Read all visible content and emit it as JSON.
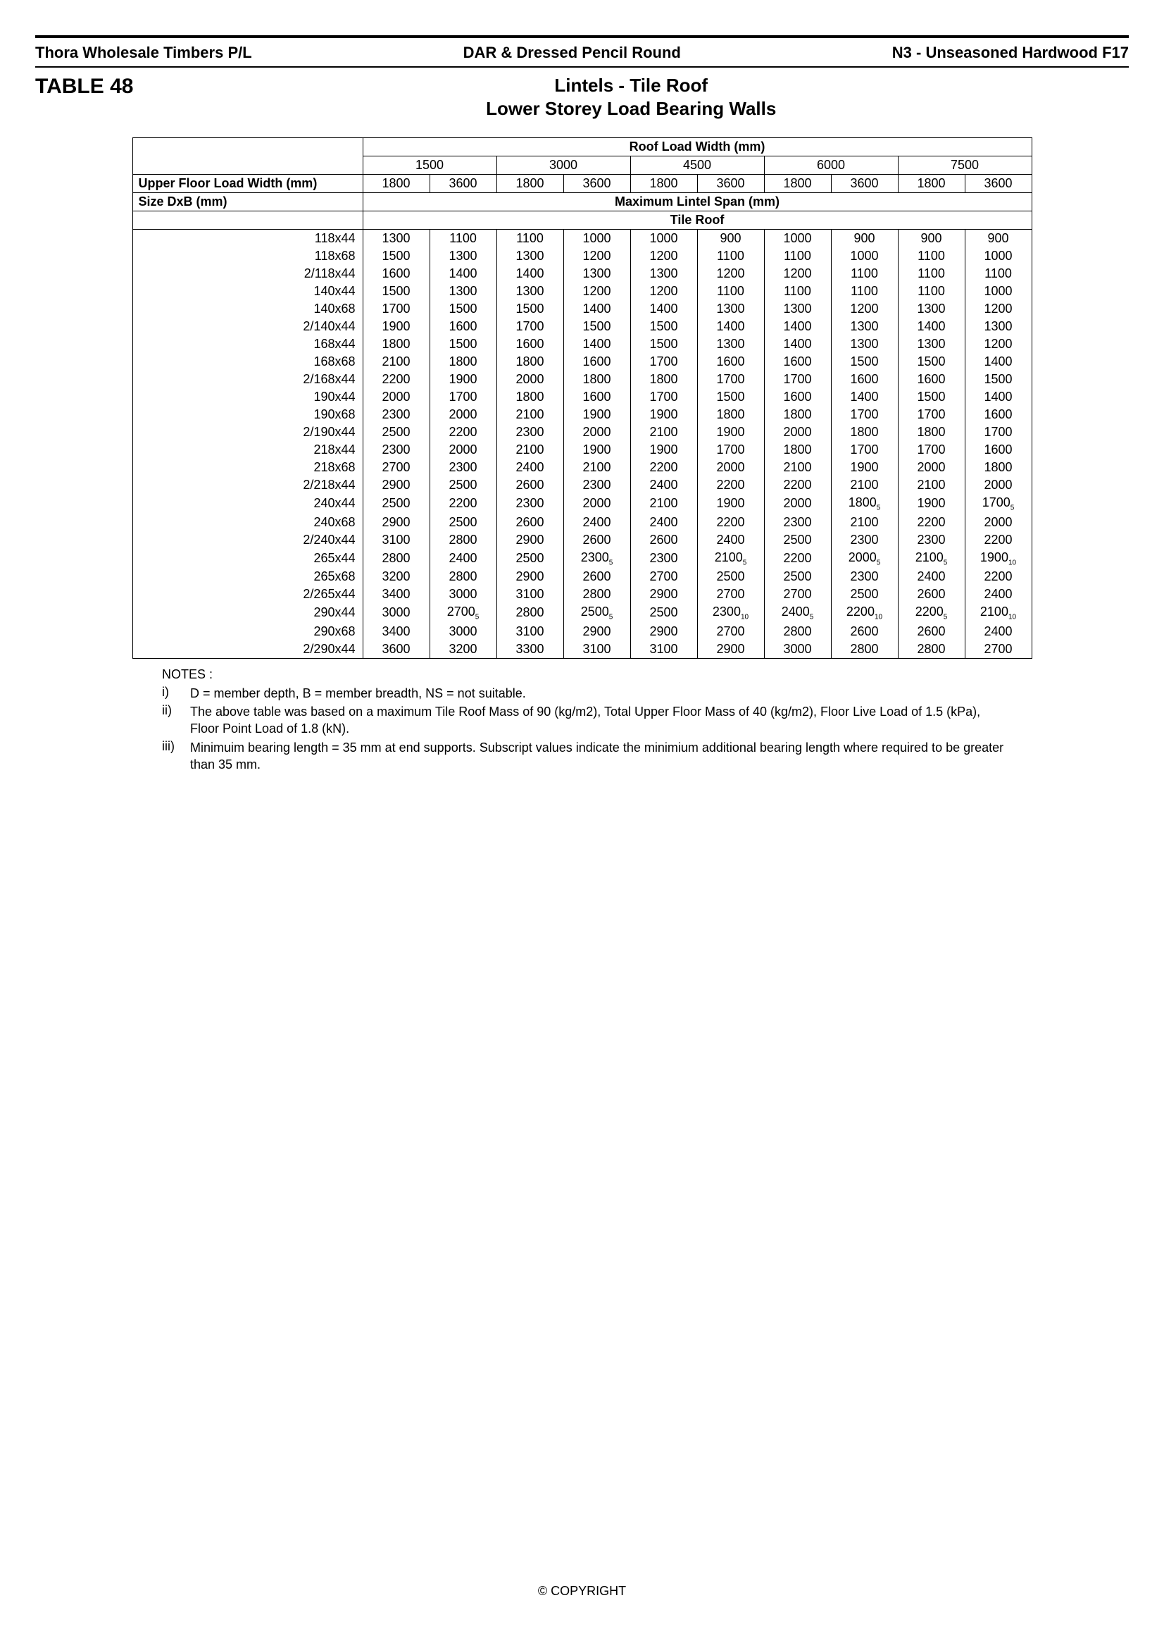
{
  "header": {
    "left": "Thora Wholesale Timbers P/L",
    "center": "DAR & Dressed Pencil Round",
    "right": "N3 - Unseasoned Hardwood F17"
  },
  "title": {
    "table_num": "TABLE 48",
    "line1": "Lintels - Tile Roof",
    "line2": "Lower Storey Load Bearing Walls"
  },
  "table": {
    "roof_load_width_label": "Roof Load Width (mm)",
    "roof_load_widths": [
      "1500",
      "3000",
      "4500",
      "6000",
      "7500"
    ],
    "upper_floor_label": "Upper Floor Load Width (mm)",
    "upper_floor_widths": [
      "1800",
      "3600",
      "1800",
      "3600",
      "1800",
      "3600",
      "1800",
      "3600",
      "1800",
      "3600"
    ],
    "size_label": "Size DxB (mm)",
    "max_span_label": "Maximum Lintel Span (mm)",
    "roof_type_label": "Tile Roof",
    "rows": [
      {
        "size": "118x44",
        "v": [
          "1300",
          "1100",
          "1100",
          "1000",
          "1000",
          "900",
          "1000",
          "900",
          "900",
          "900"
        ]
      },
      {
        "size": "118x68",
        "v": [
          "1500",
          "1300",
          "1300",
          "1200",
          "1200",
          "1100",
          "1100",
          "1000",
          "1100",
          "1000"
        ]
      },
      {
        "size": "2/118x44",
        "v": [
          "1600",
          "1400",
          "1400",
          "1300",
          "1300",
          "1200",
          "1200",
          "1100",
          "1100",
          "1100"
        ]
      },
      {
        "size": "140x44",
        "v": [
          "1500",
          "1300",
          "1300",
          "1200",
          "1200",
          "1100",
          "1100",
          "1100",
          "1100",
          "1000"
        ]
      },
      {
        "size": "140x68",
        "v": [
          "1700",
          "1500",
          "1500",
          "1400",
          "1400",
          "1300",
          "1300",
          "1200",
          "1300",
          "1200"
        ]
      },
      {
        "size": "2/140x44",
        "v": [
          "1900",
          "1600",
          "1700",
          "1500",
          "1500",
          "1400",
          "1400",
          "1300",
          "1400",
          "1300"
        ]
      },
      {
        "size": "168x44",
        "v": [
          "1800",
          "1500",
          "1600",
          "1400",
          "1500",
          "1300",
          "1400",
          "1300",
          "1300",
          "1200"
        ]
      },
      {
        "size": "168x68",
        "v": [
          "2100",
          "1800",
          "1800",
          "1600",
          "1700",
          "1600",
          "1600",
          "1500",
          "1500",
          "1400"
        ]
      },
      {
        "size": "2/168x44",
        "v": [
          "2200",
          "1900",
          "2000",
          "1800",
          "1800",
          "1700",
          "1700",
          "1600",
          "1600",
          "1500"
        ]
      },
      {
        "size": "190x44",
        "v": [
          "2000",
          "1700",
          "1800",
          "1600",
          "1700",
          "1500",
          "1600",
          "1400",
          "1500",
          "1400"
        ]
      },
      {
        "size": "190x68",
        "v": [
          "2300",
          "2000",
          "2100",
          "1900",
          "1900",
          "1800",
          "1800",
          "1700",
          "1700",
          "1600"
        ]
      },
      {
        "size": "2/190x44",
        "v": [
          "2500",
          "2200",
          "2300",
          "2000",
          "2100",
          "1900",
          "2000",
          "1800",
          "1800",
          "1700"
        ]
      },
      {
        "size": "218x44",
        "v": [
          "2300",
          "2000",
          "2100",
          "1900",
          "1900",
          "1700",
          "1800",
          "1700",
          "1700",
          "1600"
        ]
      },
      {
        "size": "218x68",
        "v": [
          "2700",
          "2300",
          "2400",
          "2100",
          "2200",
          "2000",
          "2100",
          "1900",
          "2000",
          "1800"
        ]
      },
      {
        "size": "2/218x44",
        "v": [
          "2900",
          "2500",
          "2600",
          "2300",
          "2400",
          "2200",
          "2200",
          "2100",
          "2100",
          "2000"
        ]
      },
      {
        "size": "240x44",
        "v": [
          "2500",
          "2200",
          "2300",
          "2000",
          "2100",
          "1900",
          "2000",
          {
            "val": "1800",
            "sub": "5"
          },
          "1900",
          {
            "val": "1700",
            "sub": "5"
          }
        ]
      },
      {
        "size": "240x68",
        "v": [
          "2900",
          "2500",
          "2600",
          "2400",
          "2400",
          "2200",
          "2300",
          "2100",
          "2200",
          "2000"
        ]
      },
      {
        "size": "2/240x44",
        "v": [
          "3100",
          "2800",
          "2900",
          "2600",
          "2600",
          "2400",
          "2500",
          "2300",
          "2300",
          "2200"
        ]
      },
      {
        "size": "265x44",
        "v": [
          "2800",
          "2400",
          "2500",
          {
            "val": "2300",
            "sub": "5"
          },
          "2300",
          {
            "val": "2100",
            "sub": "5"
          },
          "2200",
          {
            "val": "2000",
            "sub": "5"
          },
          {
            "val": "2100",
            "sub": "5"
          },
          {
            "val": "1900",
            "sub": "10"
          }
        ]
      },
      {
        "size": "265x68",
        "v": [
          "3200",
          "2800",
          "2900",
          "2600",
          "2700",
          "2500",
          "2500",
          "2300",
          "2400",
          "2200"
        ]
      },
      {
        "size": "2/265x44",
        "v": [
          "3400",
          "3000",
          "3100",
          "2800",
          "2900",
          "2700",
          "2700",
          "2500",
          "2600",
          "2400"
        ]
      },
      {
        "size": "290x44",
        "v": [
          "3000",
          {
            "val": "2700",
            "sub": "5"
          },
          "2800",
          {
            "val": "2500",
            "sub": "5"
          },
          "2500",
          {
            "val": "2300",
            "sub": "10"
          },
          {
            "val": "2400",
            "sub": "5"
          },
          {
            "val": "2200",
            "sub": "10"
          },
          {
            "val": "2200",
            "sub": "5"
          },
          {
            "val": "2100",
            "sub": "10"
          }
        ]
      },
      {
        "size": "290x68",
        "v": [
          "3400",
          "3000",
          "3100",
          "2900",
          "2900",
          "2700",
          "2800",
          "2600",
          "2600",
          "2400"
        ]
      },
      {
        "size": "2/290x44",
        "v": [
          "3600",
          "3200",
          "3300",
          "3100",
          "3100",
          "2900",
          "3000",
          "2800",
          "2800",
          "2700"
        ]
      }
    ]
  },
  "notes": {
    "header": "NOTES :",
    "items": [
      {
        "num": "i)",
        "text": "D = member depth,    B = member breadth,    NS = not suitable."
      },
      {
        "num": "ii)",
        "text": "The above table was based on a maximum Tile Roof Mass of 90 (kg/m2), Total Upper Floor Mass of 40 (kg/m2), Floor Live Load of 1.5 (kPa), Floor Point Load of 1.8 (kN)."
      },
      {
        "num": "iii)",
        "text": "Minimuim bearing length = 35 mm at end supports. Subscript values indicate the minimium additional bearing length where required to be greater than 35 mm."
      }
    ]
  },
  "copyright": "© COPYRIGHT"
}
